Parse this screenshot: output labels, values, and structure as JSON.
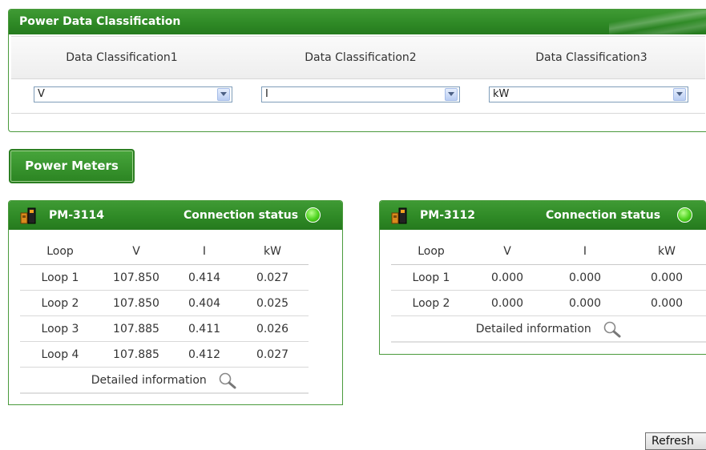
{
  "classification": {
    "title": "Power Data Classification",
    "columns": [
      {
        "label": "Data Classification1",
        "value": "V"
      },
      {
        "label": "Data Classification2",
        "value": "I"
      },
      {
        "label": "Data Classification3",
        "value": "kW"
      }
    ]
  },
  "power_meters_button": "Power Meters",
  "meters": [
    {
      "name": "PM-3114",
      "connection_label": "Connection status",
      "headers": [
        "Loop",
        "V",
        "I",
        "kW"
      ],
      "rows": [
        [
          "Loop 1",
          "107.850",
          "0.414",
          "0.027"
        ],
        [
          "Loop 2",
          "107.850",
          "0.404",
          "0.025"
        ],
        [
          "Loop 3",
          "107.885",
          "0.411",
          "0.026"
        ],
        [
          "Loop 4",
          "107.885",
          "0.412",
          "0.027"
        ]
      ],
      "detail_label": "Detailed information"
    },
    {
      "name": "PM-3112",
      "connection_label": "Connection status",
      "headers": [
        "Loop",
        "V",
        "I",
        "kW"
      ],
      "rows": [
        [
          "Loop 1",
          "0.000",
          "0.000",
          "0.000"
        ],
        [
          "Loop 2",
          "0.000",
          "0.000",
          "0.000"
        ]
      ],
      "detail_label": "Detailed information"
    }
  ],
  "refresh_button": "Refresh",
  "colors": {
    "header_green": "#2f8a26",
    "status_ok": "#4cd21d"
  },
  "icons": {
    "meter": "power-meter-icon",
    "status": "status-led-icon",
    "detail": "magnifier-icon",
    "dropdown": "chevron-down-icon"
  }
}
